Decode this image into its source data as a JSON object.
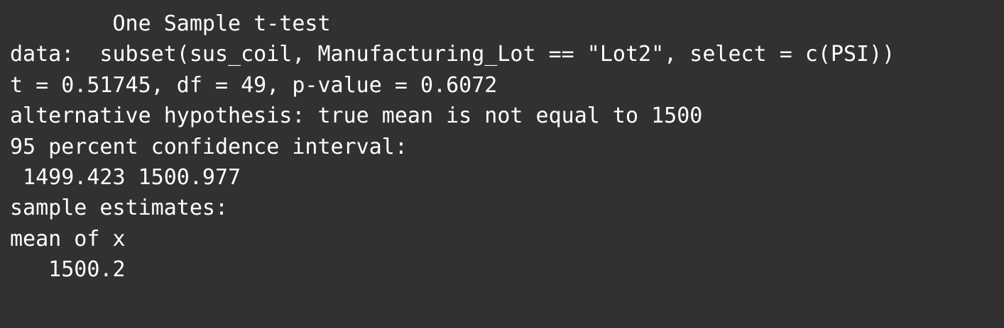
{
  "console": {
    "title": "        One Sample t-test",
    "blank": "",
    "data_line": "data:  subset(sus_coil, Manufacturing_Lot == \"Lot2\", select = c(PSI))",
    "stats_line": "t = 0.51745, df = 49, p-value = 0.6072",
    "alternative_line": "alternative hypothesis: true mean is not equal to 1500",
    "ci_header": "95 percent confidence interval:",
    "ci_values": " 1499.423 1500.977",
    "estimates_header": "sample estimates:",
    "estimate_label": "mean of x",
    "estimate_value": "   1500.2"
  }
}
